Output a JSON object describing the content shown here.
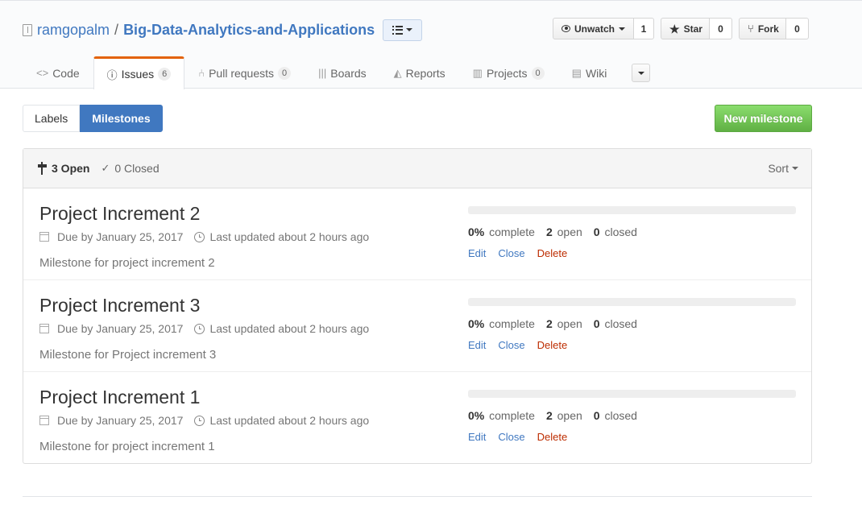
{
  "repo": {
    "owner": "ramgopalm",
    "separator": "/",
    "name": "Big-Data-Analytics-and-Applications"
  },
  "actions": {
    "watch_label": "Unwatch",
    "watch_count": "1",
    "star_label": "Star",
    "star_count": "0",
    "fork_label": "Fork",
    "fork_count": "0"
  },
  "tabs": [
    {
      "label": "Code",
      "icon": "code-icon",
      "counter": null
    },
    {
      "label": "Issues",
      "icon": "issue-icon",
      "counter": "6"
    },
    {
      "label": "Pull requests",
      "icon": "pull-request-icon",
      "counter": "0"
    },
    {
      "label": "Boards",
      "icon": "boards-icon",
      "counter": null
    },
    {
      "label": "Reports",
      "icon": "graph-icon",
      "counter": null
    },
    {
      "label": "Projects",
      "icon": "project-icon",
      "counter": "0"
    },
    {
      "label": "Wiki",
      "icon": "book-icon",
      "counter": null
    }
  ],
  "subnav": {
    "labels": "Labels",
    "milestones": "Milestones"
  },
  "new_milestone": "New milestone",
  "table": {
    "open": "3 Open",
    "closed": "0 Closed",
    "sort": "Sort"
  },
  "milestones": [
    {
      "title": "Project Increment 2",
      "due": "Due by January 25, 2017",
      "updated": "Last updated about 2 hours ago",
      "description": "Milestone for project increment 2",
      "percent_value": 0,
      "percent": "0%",
      "complete_label": "complete",
      "open_count": "2",
      "open_label": "open",
      "closed_count": "0",
      "closed_label": "closed",
      "edit": "Edit",
      "close": "Close",
      "delete": "Delete"
    },
    {
      "title": "Project Increment 3",
      "due": "Due by January 25, 2017",
      "updated": "Last updated about 2 hours ago",
      "description": "Milestone for Project increment 3",
      "percent_value": 0,
      "percent": "0%",
      "complete_label": "complete",
      "open_count": "2",
      "open_label": "open",
      "closed_count": "0",
      "closed_label": "closed",
      "edit": "Edit",
      "close": "Close",
      "delete": "Delete"
    },
    {
      "title": "Project Increment 1",
      "due": "Due by January 25, 2017",
      "updated": "Last updated about 2 hours ago",
      "description": "Milestone for project increment 1",
      "percent_value": 0,
      "percent": "0%",
      "complete_label": "complete",
      "open_count": "2",
      "open_label": "open",
      "closed_count": "0",
      "closed_label": "closed",
      "edit": "Edit",
      "close": "Close",
      "delete": "Delete"
    }
  ],
  "colors": {
    "link": "#4078c0",
    "tab_accent": "#e36209",
    "new_button": "#60b044",
    "danger": "#bd2c00"
  }
}
